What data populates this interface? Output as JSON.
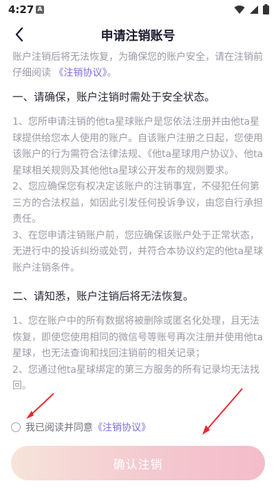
{
  "status_bar": {
    "time": "4:27",
    "notification_badge": "A",
    "icons": [
      "wifi-icon",
      "signal-icon",
      "battery-icon"
    ]
  },
  "header": {
    "back_icon": "chevron-left-icon",
    "title": "申请注销账号"
  },
  "content": {
    "intro_text": "账户注销后将无法恢复，为确保您的账户安全，请在注销前仔细阅读",
    "intro_link": "《注销协议》",
    "intro_end": "。",
    "section1_title": "一、请确保，账户注销时需处于安全状态。",
    "section1_item1": "1、您所申请注销的他ta星球账户是您依法注册并由他ta星球提供给您本人使用的账户。自该账户注册之日起，您使用该账户的行为需符合法律法规、《他ta星球用户协议》、他ta星球相关规则及其他他ta星球公开发布的规则要求。",
    "section1_item2": "2、您应确保您有权决定该账户的注销事宜，不侵犯任何第三方的合法权益，如因此引发任何投诉争议，由您自行承担责任。",
    "section1_item3": "3、在您申请注销账户前，您应确保该账户处于正常状态，无进行中的投诉纠纷或处罚，并符合本协议约定的他ta星球账户注销条件。",
    "section2_title": "二、请知悉，账户注销后将无法恢复。",
    "section2_item1": "1、您在账户中的所有数据将被删除或匿名化处理，且无法恢复，即使您使用相同的微信号等账号再次注册并使用他ta星球，也无法查询和找回注销前的相关记录；",
    "section2_item2": "2、您通过他ta星球绑定的第三方服务的所有记录均无法找回。"
  },
  "agreement": {
    "text": "我已阅读并同意",
    "link": "《注销协议》",
    "checked": false
  },
  "confirm_button": {
    "label": "确认注销"
  },
  "colors": {
    "accent": "#7b6ce0",
    "button_gradient_start": "#f7e4da",
    "button_gradient_end": "#f4bcc9",
    "annotation_arrow": "#e8282b"
  }
}
